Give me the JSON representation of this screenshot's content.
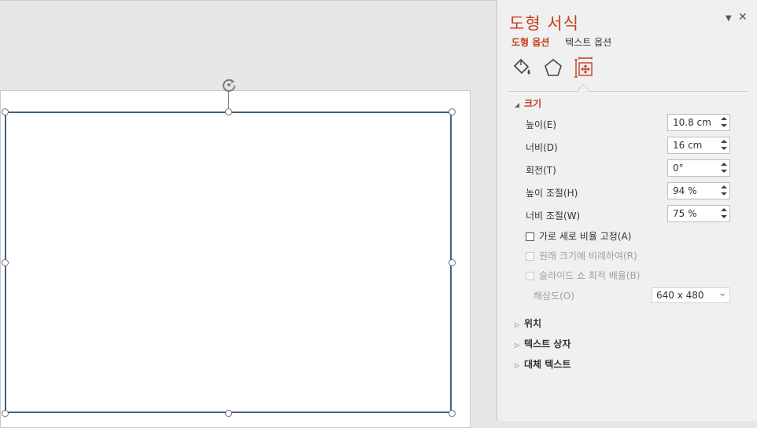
{
  "pane": {
    "title": "도형 서식",
    "tabs": [
      "도형 옵션",
      "텍스트 옵션"
    ],
    "icon_tabs": [
      "paint-bucket-icon",
      "pentagon-icon",
      "size-properties-icon"
    ],
    "accent_color": "#c43e1c"
  },
  "size_section": {
    "header": "크기",
    "fields": [
      {
        "label": "높이(E)",
        "value": "10.8 cm"
      },
      {
        "label": "너비(D)",
        "value": "16 cm"
      },
      {
        "label": "회전(T)",
        "value": "0°"
      },
      {
        "label": "높이 조절(H)",
        "value": "94 %"
      },
      {
        "label": "너비 조절(W)",
        "value": "75 %"
      }
    ],
    "checkboxes": [
      {
        "label": "가로 세로 비율 고정(A)",
        "checked": false,
        "enabled": true
      },
      {
        "label": "원래 크기에 비례하여(R)",
        "checked": false,
        "enabled": false
      },
      {
        "label": "슬라이드 쇼 최적 배율(B)",
        "checked": false,
        "enabled": false
      }
    ],
    "resolution_label": "해상도(O)",
    "resolution_value": "640 x 480"
  },
  "collapsed_sections": [
    "위치",
    "텍스트 상자",
    "대체 텍스트"
  ]
}
